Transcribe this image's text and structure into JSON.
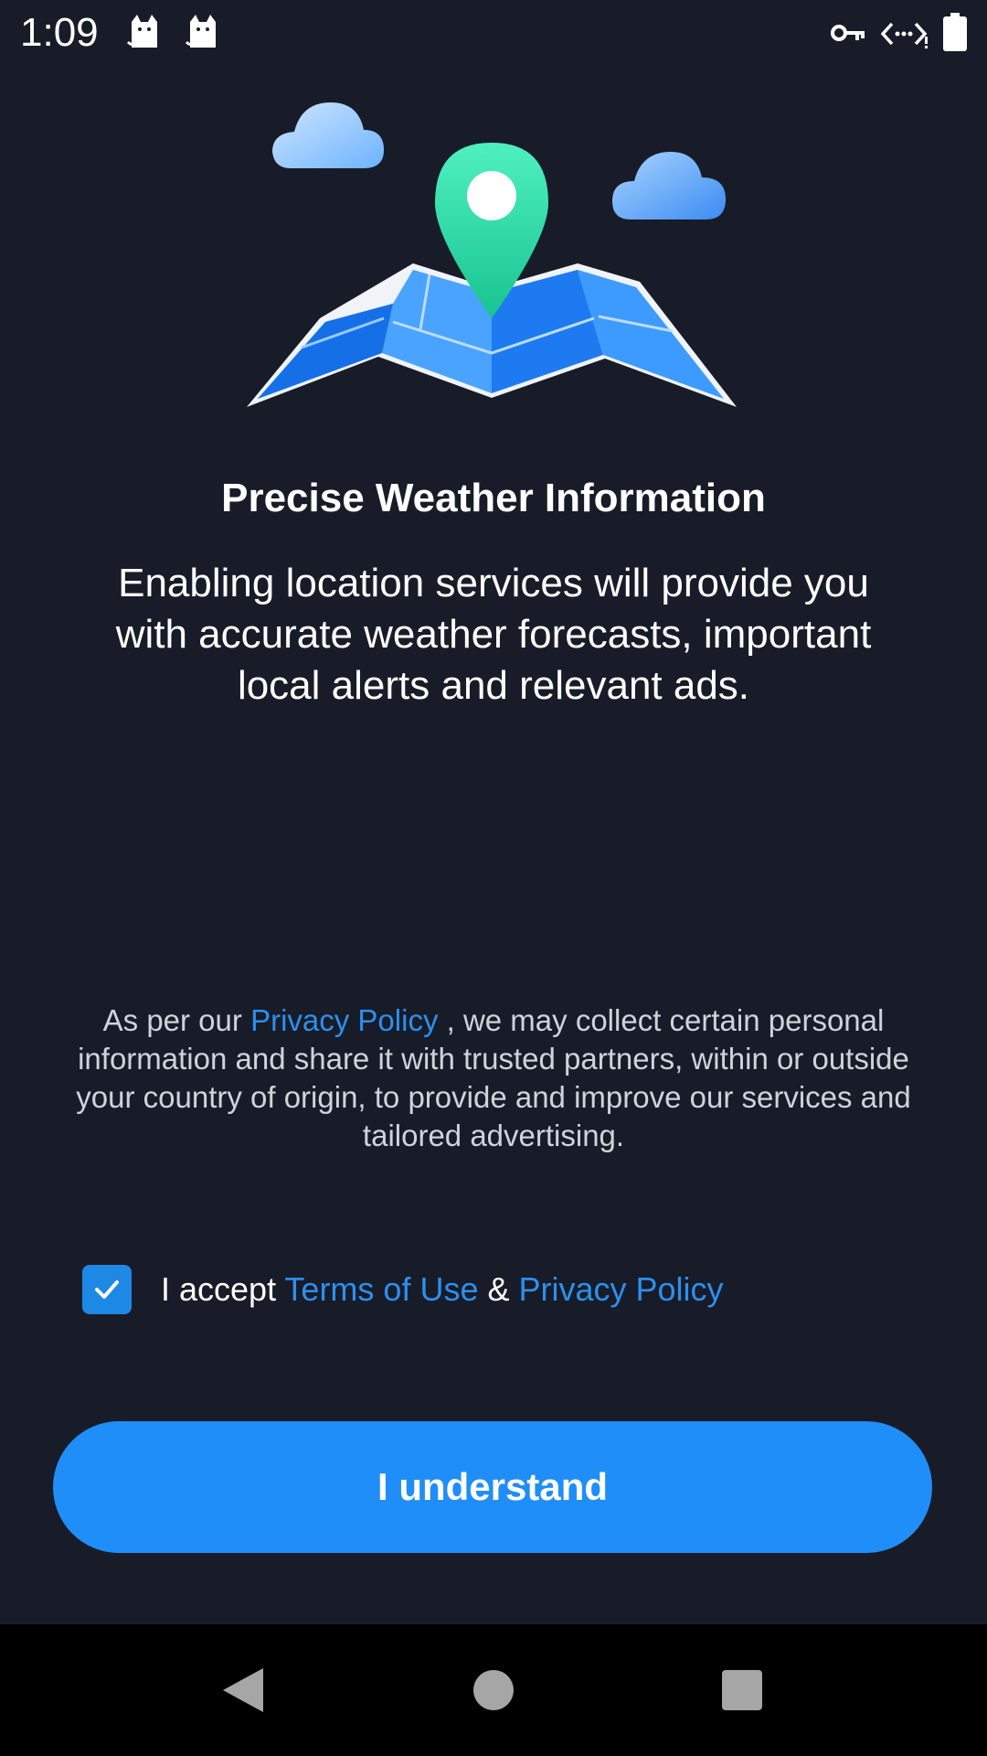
{
  "status_bar": {
    "time": "1:09",
    "icons": [
      "cat-notification-icon",
      "cat-notification-icon",
      "vpn-key-icon",
      "data-saver-icon",
      "battery-icon"
    ]
  },
  "illustration": {
    "name": "map-with-location-pin",
    "colors": {
      "pin": "#3ee0b0",
      "map": "#1e7af0",
      "cloud": "#8cc7ff"
    }
  },
  "content": {
    "title": "Precise Weather Information",
    "description": "Enabling location services will provide you with accurate weather forecasts, important local alerts and relevant ads."
  },
  "privacy_note": {
    "prefix": "As per our ",
    "link": "Privacy Policy",
    "suffix": " , we may collect certain personal information and share it with trusted partners, within or outside your country of origin, to provide and improve our services and tailored advertising."
  },
  "accept": {
    "checked": true,
    "prefix": "I accept ",
    "terms_link": "Terms of Use",
    "ampersand": " & ",
    "privacy_link": "Privacy Policy"
  },
  "cta": {
    "label": "I understand"
  },
  "nav_bar": {
    "buttons": [
      "back-icon",
      "home-icon",
      "recents-icon"
    ]
  },
  "colors": {
    "background": "#171c28",
    "link": "#2d8fee",
    "button": "#1f8ef8",
    "checkbox": "#1e88e5"
  }
}
